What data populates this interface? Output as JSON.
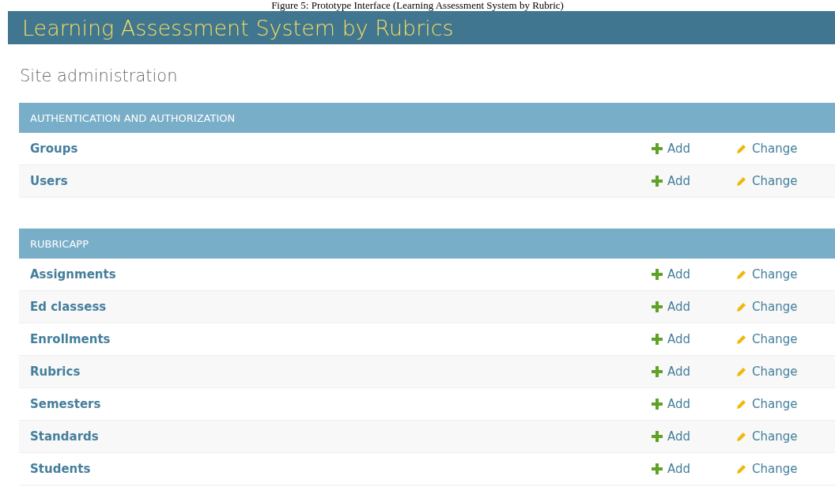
{
  "caption": "Figure 5: Prototype Interface (Learning Assessment System by Rubric)",
  "header": {
    "title": "Learning Assessment System by Rubrics"
  },
  "page_title": "Site administration",
  "modules": [
    {
      "caption": "AUTHENTICATION AND AUTHORIZATION",
      "models": [
        {
          "name": "Groups",
          "add": "Add",
          "change": "Change"
        },
        {
          "name": "Users",
          "add": "Add",
          "change": "Change"
        }
      ]
    },
    {
      "caption": "RUBRICAPP",
      "models": [
        {
          "name": "Assignments",
          "add": "Add",
          "change": "Change"
        },
        {
          "name": "Ed classess",
          "add": "Add",
          "change": "Change"
        },
        {
          "name": "Enrollments",
          "add": "Add",
          "change": "Change"
        },
        {
          "name": "Rubrics",
          "add": "Add",
          "change": "Change"
        },
        {
          "name": "Semesters",
          "add": "Add",
          "change": "Change"
        },
        {
          "name": "Standards",
          "add": "Add",
          "change": "Change"
        },
        {
          "name": "Students",
          "add": "Add",
          "change": "Change"
        }
      ]
    }
  ]
}
